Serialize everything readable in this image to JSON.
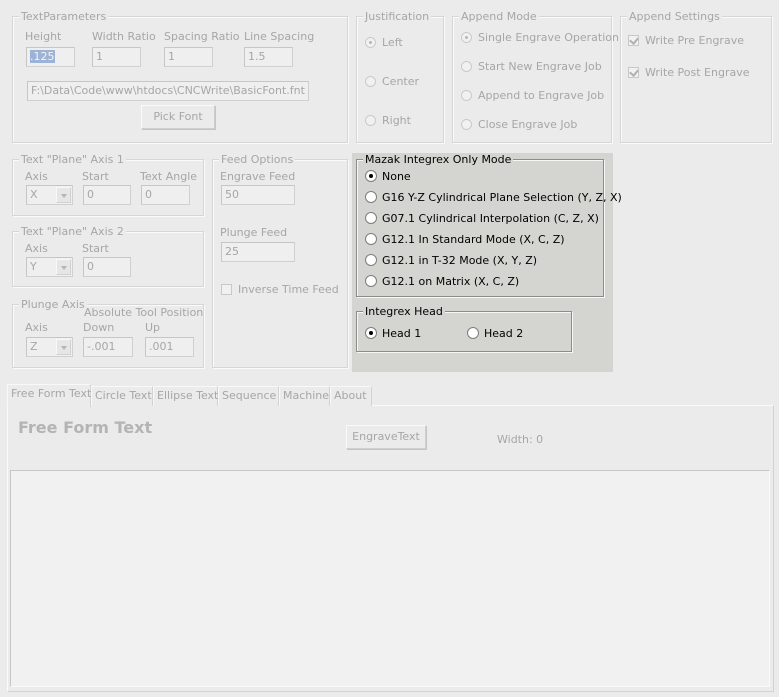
{
  "text_parameters": {
    "legend": "TextParameters",
    "height_label": "Height",
    "height_value": ".125",
    "width_ratio_label": "Width Ratio",
    "width_ratio_value": "1",
    "spacing_ratio_label": "Spacing Ratio",
    "spacing_ratio_value": "1",
    "line_spacing_label": "Line Spacing",
    "line_spacing_value": "1.5",
    "font_path": "F:\\Data\\Code\\www\\htdocs\\CNCWrite\\BasicFont.fnt",
    "pick_font_label": "Pick Font"
  },
  "justification": {
    "legend": "Justification",
    "options": [
      "Left",
      "Center",
      "Right"
    ],
    "selected": "Left"
  },
  "append_mode": {
    "legend": "Append Mode",
    "options": [
      "Single Engrave Operation",
      "Start New Engrave Job",
      "Append to Engrave Job",
      "Close Engrave Job"
    ],
    "selected": "Single Engrave Operation"
  },
  "append_settings": {
    "legend": "Append Settings",
    "write_pre_label": "Write Pre Engrave",
    "write_pre_checked": true,
    "write_post_label": "Write Post Engrave",
    "write_post_checked": true
  },
  "axis1": {
    "legend": "Text \"Plane\" Axis 1",
    "axis_label": "Axis",
    "axis_value": "X",
    "start_label": "Start",
    "start_value": "0",
    "angle_label": "Text Angle",
    "angle_value": "0"
  },
  "axis2": {
    "legend": "Text \"Plane\" Axis 2",
    "axis_label": "Axis",
    "axis_value": "Y",
    "start_label": "Start",
    "start_value": "0"
  },
  "plunge_axis": {
    "legend": "Plunge Axis",
    "abs_label": "Absolute Tool Position",
    "axis_label": "Axis",
    "axis_value": "Z",
    "down_label": "Down",
    "down_value": "-.001",
    "up_label": "Up",
    "up_value": ".001"
  },
  "feed_options": {
    "legend": "Feed Options",
    "engrave_label": "Engrave Feed",
    "engrave_value": "50",
    "plunge_label": "Plunge Feed",
    "plunge_value": "25",
    "inverse_label": "Inverse Time Feed",
    "inverse_checked": false
  },
  "mazak": {
    "legend": "Mazak Integrex Only Mode",
    "options": [
      "None",
      "G16 Y-Z Cylindrical Plane Selection (Y, Z, X)",
      "G07.1 Cylindrical Interpolation (C, Z, X)",
      "G12.1 In Standard Mode (X, C, Z)",
      "G12.1 in T-32 Mode (X, Y, Z)",
      "G12.1 on Matrix (X, C, Z)"
    ],
    "selected": "None"
  },
  "integrex_head": {
    "legend": "Integrex Head",
    "options": [
      "Head 1",
      "Head 2"
    ],
    "selected": "Head 1"
  },
  "tabs": [
    "Free Form Text",
    "Circle Text",
    "Ellipse Text",
    "Sequence",
    "Machine",
    "About"
  ],
  "active_tab": "Free Form Text",
  "free_form": {
    "title": "Free Form Text",
    "engrave_label": "EngraveText",
    "width_label": "Width: 0",
    "text": ""
  }
}
